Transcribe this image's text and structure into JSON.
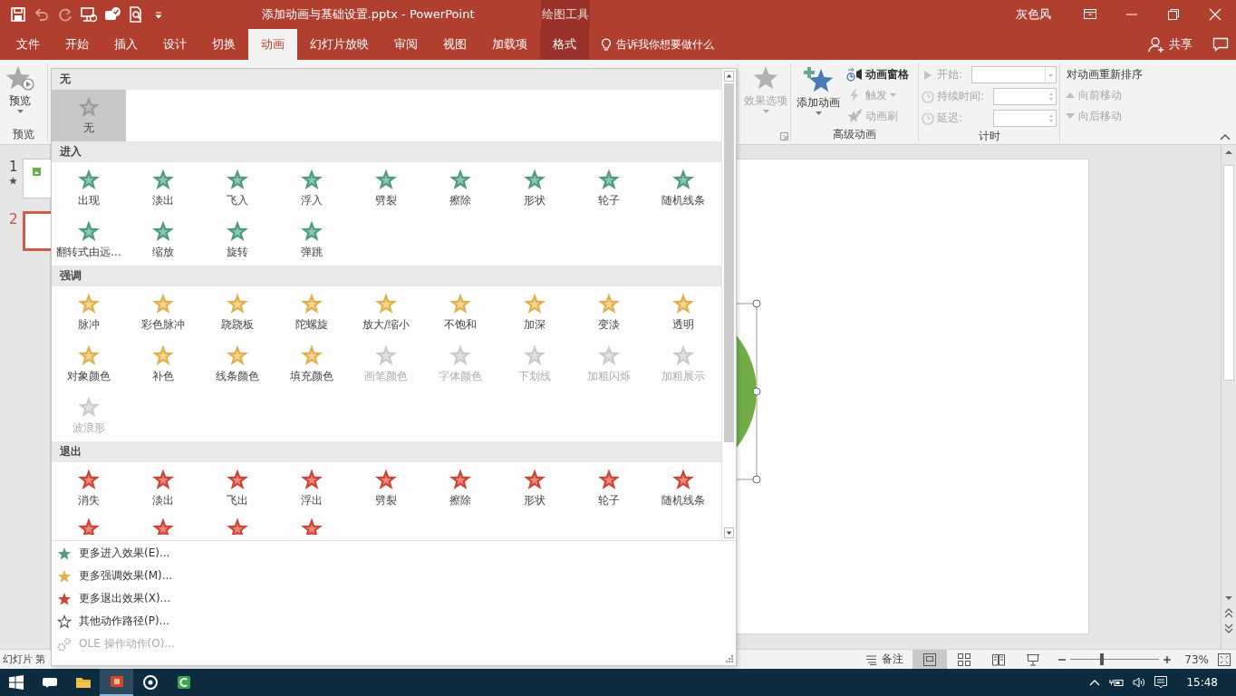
{
  "title_bar": {
    "quick_access": [
      {
        "kind": "save",
        "disabled": false
      },
      {
        "kind": "undo",
        "disabled": true
      },
      {
        "kind": "redo",
        "disabled": true
      },
      {
        "kind": "presenter",
        "disabled": false
      },
      {
        "kind": "check",
        "disabled": false
      },
      {
        "kind": "print_preview",
        "disabled": false
      },
      {
        "kind": "customize",
        "disabled": false
      }
    ],
    "document_title": "添加动画与基础设置.pptx - PowerPoint",
    "tool_group": "绘图工具",
    "user": "灰色风"
  },
  "tabs": [
    {
      "label": "文件",
      "selected": false,
      "kind": "file"
    },
    {
      "label": "开始",
      "selected": false,
      "kind": "normal"
    },
    {
      "label": "插入",
      "selected": false,
      "kind": "normal"
    },
    {
      "label": "设计",
      "selected": false,
      "kind": "normal"
    },
    {
      "label": "切换",
      "selected": false,
      "kind": "normal"
    },
    {
      "label": "动画",
      "selected": true,
      "kind": "normal"
    },
    {
      "label": "幻灯片放映",
      "selected": false,
      "kind": "normal"
    },
    {
      "label": "审阅",
      "selected": false,
      "kind": "normal"
    },
    {
      "label": "视图",
      "selected": false,
      "kind": "normal"
    },
    {
      "label": "加载项",
      "selected": false,
      "kind": "normal"
    },
    {
      "label": "格式",
      "selected": false,
      "kind": "context"
    }
  ],
  "tell_me": "告诉我你想要做什么",
  "share": "共享",
  "ribbon": {
    "preview_group": {
      "button": "预览",
      "label": "预览"
    },
    "effect_options": {
      "label": "效果选项",
      "disabled": true
    },
    "advanced_group": {
      "label": "高级动画",
      "add_animation": {
        "label": "添加动画",
        "disabled": false
      },
      "commands": [
        {
          "label": "动画窗格",
          "kind": "pane",
          "disabled": false
        },
        {
          "label": "触发",
          "kind": "trigger",
          "disabled": true
        },
        {
          "label": "动画刷",
          "kind": "painter",
          "disabled": true
        }
      ]
    },
    "timing_group": {
      "label": "计时",
      "fields": [
        {
          "label": "开始:",
          "kind": "dropdown",
          "disabled": true
        },
        {
          "label": "持续时间:",
          "kind": "spinner",
          "disabled": true
        },
        {
          "label": "延迟:",
          "kind": "spinner",
          "disabled": true
        }
      ]
    },
    "reorder_group": {
      "title": "对动画重新排序",
      "commands": [
        {
          "label": "向前移动",
          "kind": "up",
          "disabled": true
        },
        {
          "label": "向后移动",
          "kind": "down",
          "disabled": true
        }
      ]
    }
  },
  "slides": [
    {
      "number": "1",
      "selected": false,
      "animated": true
    },
    {
      "number": "2",
      "selected": true,
      "animated": false
    }
  ],
  "canvas": {
    "shapes": [
      {
        "kind": "circle",
        "selected": true
      }
    ]
  },
  "gallery": {
    "sections": [
      {
        "kind": "none",
        "title": "无",
        "items": [
          {
            "label": "无",
            "selected": true,
            "disabled": false
          }
        ]
      },
      {
        "kind": "enter",
        "title": "进入",
        "items": [
          {
            "label": "出现",
            "selected": false,
            "disabled": false
          },
          {
            "label": "淡出",
            "selected": false,
            "disabled": false
          },
          {
            "label": "飞入",
            "selected": false,
            "disabled": false
          },
          {
            "label": "浮入",
            "selected": false,
            "disabled": false
          },
          {
            "label": "劈裂",
            "selected": false,
            "disabled": false
          },
          {
            "label": "擦除",
            "selected": false,
            "disabled": false
          },
          {
            "label": "形状",
            "selected": false,
            "disabled": false
          },
          {
            "label": "轮子",
            "selected": false,
            "disabled": false
          },
          {
            "label": "随机线条",
            "selected": false,
            "disabled": false
          },
          {
            "label": "翻转式由远...",
            "selected": false,
            "disabled": false
          },
          {
            "label": "缩放",
            "selected": false,
            "disabled": false
          },
          {
            "label": "旋转",
            "selected": false,
            "disabled": false
          },
          {
            "label": "弹跳",
            "selected": false,
            "disabled": false
          }
        ]
      },
      {
        "kind": "emphasis",
        "title": "强调",
        "items": [
          {
            "label": "脉冲",
            "selected": false,
            "disabled": false
          },
          {
            "label": "彩色脉冲",
            "selected": false,
            "disabled": false
          },
          {
            "label": "跷跷板",
            "selected": false,
            "disabled": false
          },
          {
            "label": "陀螺旋",
            "selected": false,
            "disabled": false
          },
          {
            "label": "放大/缩小",
            "selected": false,
            "disabled": false
          },
          {
            "label": "不饱和",
            "selected": false,
            "disabled": false
          },
          {
            "label": "加深",
            "selected": false,
            "disabled": false
          },
          {
            "label": "变淡",
            "selected": false,
            "disabled": false
          },
          {
            "label": "透明",
            "selected": false,
            "disabled": false
          },
          {
            "label": "对象颜色",
            "selected": false,
            "disabled": false
          },
          {
            "label": "补色",
            "selected": false,
            "disabled": false
          },
          {
            "label": "线条颜色",
            "selected": false,
            "disabled": false
          },
          {
            "label": "填充颜色",
            "selected": false,
            "disabled": false
          },
          {
            "label": "画笔颜色",
            "selected": false,
            "disabled": true
          },
          {
            "label": "字体颜色",
            "selected": false,
            "disabled": true
          },
          {
            "label": "下划线",
            "selected": false,
            "disabled": true
          },
          {
            "label": "加粗闪烁",
            "selected": false,
            "disabled": true
          },
          {
            "label": "加粗展示",
            "selected": false,
            "disabled": true
          },
          {
            "label": "波浪形",
            "selected": false,
            "disabled": true
          }
        ]
      },
      {
        "kind": "exit",
        "title": "退出",
        "items": [
          {
            "label": "消失",
            "selected": false,
            "disabled": false
          },
          {
            "label": "淡出",
            "selected": false,
            "disabled": false
          },
          {
            "label": "飞出",
            "selected": false,
            "disabled": false
          },
          {
            "label": "浮出",
            "selected": false,
            "disabled": false
          },
          {
            "label": "劈裂",
            "selected": false,
            "disabled": false
          },
          {
            "label": "擦除",
            "selected": false,
            "disabled": false
          },
          {
            "label": "形状",
            "selected": false,
            "disabled": false
          },
          {
            "label": "轮子",
            "selected": false,
            "disabled": false
          },
          {
            "label": "随机线条",
            "selected": false,
            "disabled": false
          },
          {
            "selected": false,
            "disabled": false
          },
          {
            "selected": false,
            "disabled": false
          },
          {
            "selected": false,
            "disabled": false
          },
          {
            "selected": false,
            "disabled": false
          }
        ]
      }
    ],
    "menu": [
      {
        "label": "更多进入效果(E)...",
        "kind": "enter",
        "disabled": false
      },
      {
        "label": "更多强调效果(M)...",
        "kind": "emphasis",
        "disabled": false
      },
      {
        "label": "更多退出效果(X)...",
        "kind": "exit",
        "disabled": false
      },
      {
        "label": "其他动作路径(P)...",
        "kind": "path",
        "disabled": false
      },
      {
        "label": "OLE 操作动作(O)...",
        "kind": "ole",
        "disabled": true
      }
    ]
  },
  "status_bar": {
    "slide_info": "幻灯片 第",
    "notes": "备注",
    "views": [
      {
        "kind": "normal",
        "selected": true
      },
      {
        "kind": "sorter",
        "selected": false
      },
      {
        "kind": "reading",
        "selected": false
      },
      {
        "kind": "show",
        "selected": false
      }
    ],
    "zoom": {
      "level": 0.35,
      "reading": "73%"
    }
  },
  "taskbar": {
    "apps": [
      {
        "kind": "cortana",
        "selected": false
      },
      {
        "kind": "explorer",
        "selected": false
      },
      {
        "kind": "powerpoint",
        "selected": true
      },
      {
        "kind": "circle",
        "selected": false
      },
      {
        "kind": "editor",
        "selected": false
      }
    ],
    "time": "15:48"
  }
}
